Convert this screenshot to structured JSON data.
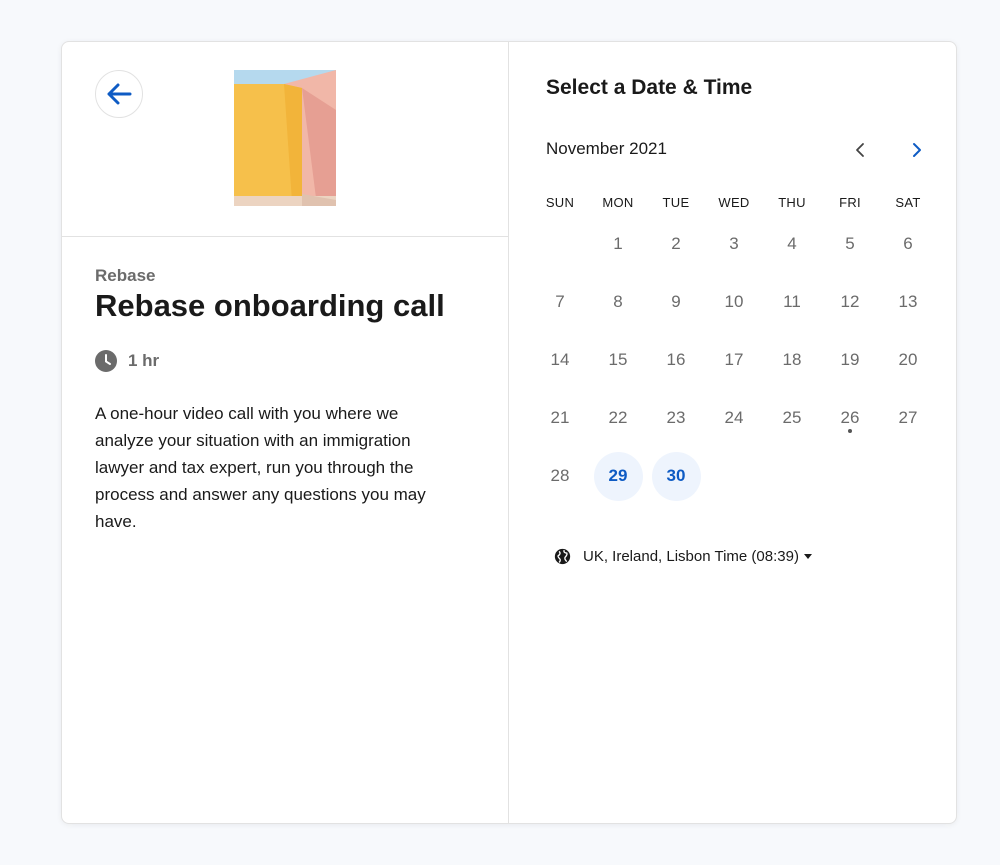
{
  "event": {
    "organization": "Rebase",
    "title": "Rebase onboarding call",
    "duration": "1 hr",
    "description": "A one-hour video call with you where we analyze your situation with an immigration lawyer and tax expert, run you through the process and answer any questions you may have."
  },
  "icons": {
    "back": "arrow-left-icon",
    "duration": "clock-icon",
    "prev": "chevron-left-icon",
    "next": "chevron-right-icon",
    "timezone": "globe-icon"
  },
  "calendar": {
    "heading": "Select a Date & Time",
    "month": "November 2021",
    "weekdays": [
      "SUN",
      "MON",
      "TUE",
      "WED",
      "THU",
      "FRI",
      "SAT"
    ],
    "leading_blank_days": 1,
    "days_in_month": 30,
    "available_days": [
      29,
      30
    ],
    "today": 26
  },
  "timezone": {
    "label": "UK, Ireland, Lisbon Time (08:39)"
  },
  "colors": {
    "accent": "#0e5bc4",
    "available_bg": "#eef4fd",
    "muted_text": "#6b6b6b",
    "border": "#e2e2e2"
  }
}
